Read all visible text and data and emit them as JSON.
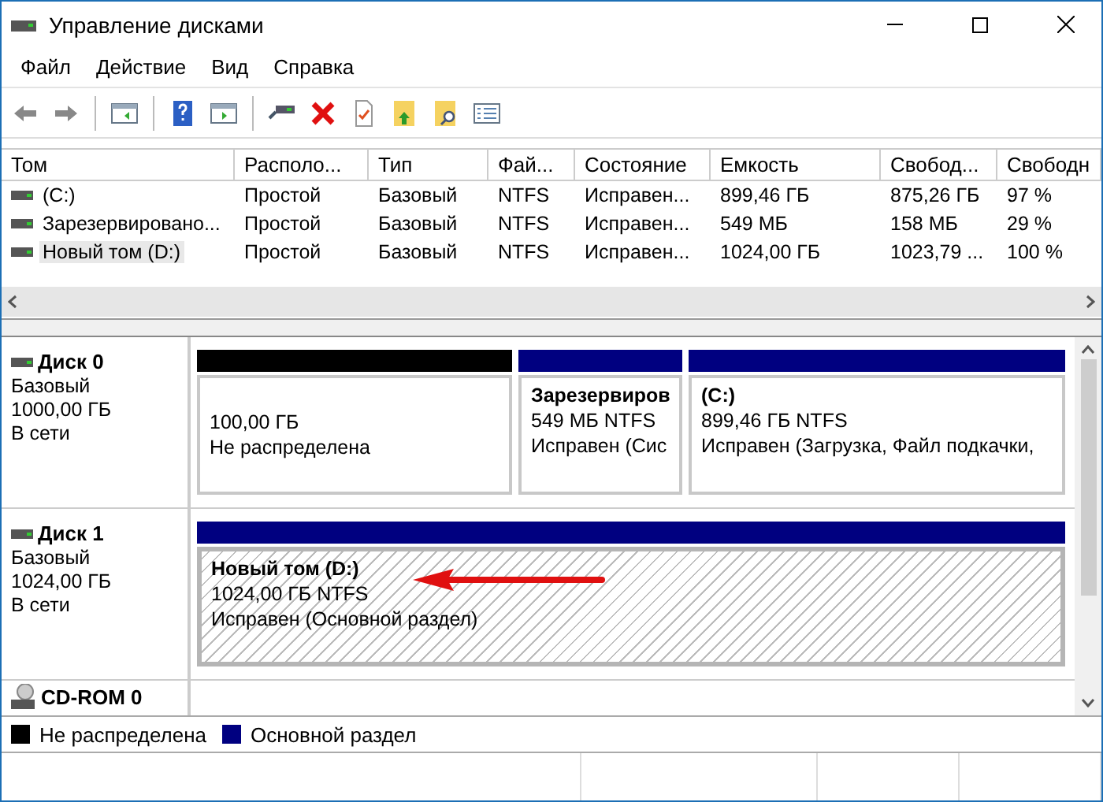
{
  "window": {
    "title": "Управление дисками"
  },
  "menu": [
    "Файл",
    "Действие",
    "Вид",
    "Справка"
  ],
  "volumes": {
    "columns": [
      "Том",
      "Располо...",
      "Тип",
      "Фай...",
      "Состояние",
      "Емкость",
      "Свобод...",
      "Свободн"
    ],
    "rows": [
      {
        "cells": [
          "(C:)",
          "Простой",
          "Базовый",
          "NTFS",
          "Исправен...",
          "899,46 ГБ",
          "875,26 ГБ",
          "97 %"
        ],
        "selected": false
      },
      {
        "cells": [
          "Зарезервировано...",
          "Простой",
          "Базовый",
          "NTFS",
          "Исправен...",
          "549 МБ",
          "158 МБ",
          "29 %"
        ],
        "selected": false
      },
      {
        "cells": [
          "Новый том (D:)",
          "Простой",
          "Базовый",
          "NTFS",
          "Исправен...",
          "1024,00 ГБ",
          "1023,79 ...",
          "100 %"
        ],
        "selected": true
      }
    ]
  },
  "disks": [
    {
      "kind": "disk",
      "name": "Диск 0",
      "type": "Базовый",
      "size": "1000,00 ГБ",
      "status": "В сети",
      "partitions": [
        {
          "kind": "unallocated",
          "size": "100,00 ГБ",
          "status": "Не распределена",
          "selected": false
        },
        {
          "kind": "primary",
          "title": "Зарезервиров",
          "size": "549 МБ NTFS",
          "status": "Исправен (Сис",
          "selected": false
        },
        {
          "kind": "primary",
          "title": "(C:)",
          "size": "899,46 ГБ NTFS",
          "status": "Исправен (Загрузка, Файл подкачки,",
          "selected": false
        }
      ]
    },
    {
      "kind": "disk",
      "name": "Диск 1",
      "type": "Базовый",
      "size": "1024,00 ГБ",
      "status": "В сети",
      "partitions": [
        {
          "kind": "primary",
          "title": "Новый том  (D:)",
          "size": "1024,00 ГБ NTFS",
          "status": "Исправен (Основной раздел)",
          "selected": true
        }
      ]
    },
    {
      "kind": "cdrom",
      "name": "CD-ROM 0"
    }
  ],
  "legend": [
    {
      "label": "Не распределена",
      "color": "#000000"
    },
    {
      "label": "Основной раздел",
      "color": "#000080"
    }
  ]
}
